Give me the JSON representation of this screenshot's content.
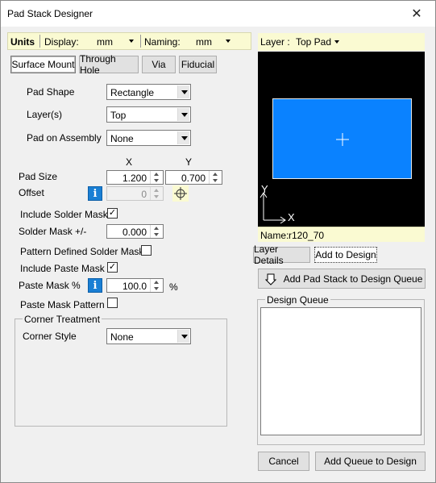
{
  "window": {
    "title": "Pad Stack Designer"
  },
  "topbar": {
    "units_label": "Units",
    "display_label": "Display:",
    "display_value": "mm",
    "naming_label": "Naming:",
    "naming_value": "mm"
  },
  "tabs": [
    {
      "label": "Surface Mount",
      "active": true
    },
    {
      "label": "Through Hole",
      "active": false
    },
    {
      "label": "Via",
      "active": false
    },
    {
      "label": "Fiducial",
      "active": false
    }
  ],
  "form": {
    "pad_shape_label": "Pad Shape",
    "pad_shape_value": "Rectangle",
    "layers_label": "Layer(s)",
    "layers_value": "Top",
    "pad_on_assembly_label": "Pad on Assembly",
    "pad_on_assembly_value": "None",
    "col_x": "X",
    "col_y": "Y",
    "pad_size_label": "Pad Size",
    "pad_size_x": "1.200",
    "pad_size_y": "0.700",
    "offset_label": "Offset",
    "offset_x": "0",
    "include_solder_mask_label": "Include Solder Mask",
    "include_solder_mask_checked": "✓",
    "solder_mask_label": "Solder Mask +/-",
    "solder_mask_value": "0.000",
    "pattern_defined_label": "Pattern Defined Solder Mask",
    "pattern_defined_checked": "",
    "include_paste_mask_label": "Include Paste Mask",
    "include_paste_mask_checked": "✓",
    "paste_mask_label": "Paste Mask %",
    "paste_mask_value": "100.0",
    "paste_mask_unit": "%",
    "paste_mask_pattern_label": "Paste Mask Pattern",
    "paste_mask_pattern_checked": ""
  },
  "corner": {
    "group_title": "Corner Treatment",
    "style_label": "Corner Style",
    "style_value": "None"
  },
  "preview": {
    "layer_label": "Layer :",
    "layer_value": "Top Pad",
    "axis_y": "Y",
    "axis_x": "X",
    "name_label": "Name:",
    "name_value": "r120_70",
    "pad_color": "#0a82ff"
  },
  "right_tabs": [
    {
      "label": "Layer Details",
      "active": false
    },
    {
      "label": "Add to Design",
      "active": true
    }
  ],
  "queue": {
    "add_button": "Add Pad Stack to Design Queue",
    "group_title": "Design Queue"
  },
  "buttons": {
    "cancel": "Cancel",
    "add_queue": "Add Queue to Design"
  },
  "icons": {
    "close": "close-icon",
    "info": "info-icon",
    "target": "crosshair-target-icon",
    "add_arrow": "down-arrow-icon"
  }
}
